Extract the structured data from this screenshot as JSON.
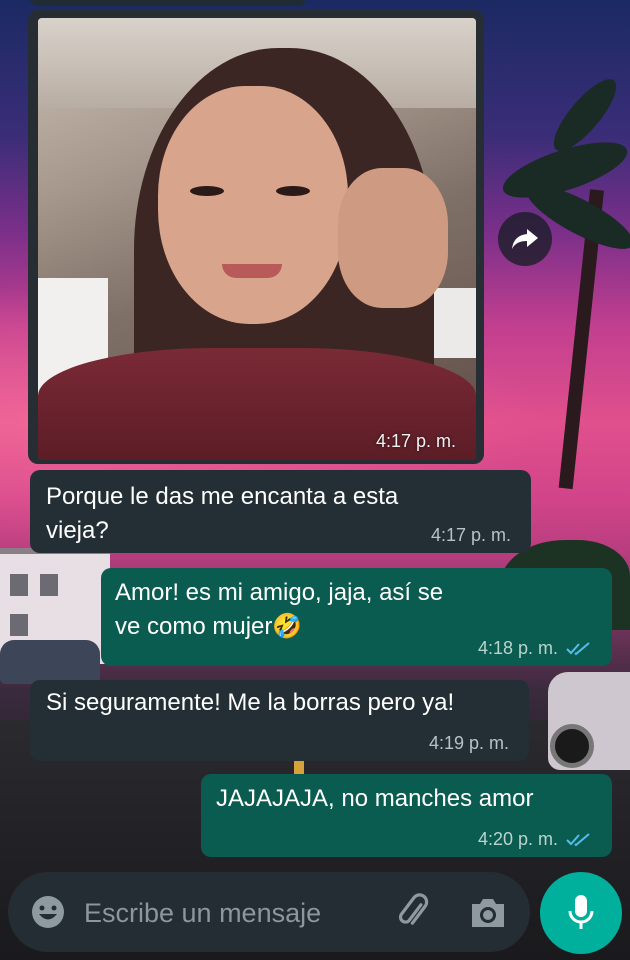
{
  "messages": [
    {
      "direction": "incoming",
      "type": "image",
      "time": "4:17 p. m."
    },
    {
      "direction": "incoming",
      "type": "text",
      "text": "Porque le das me encanta a esta vieja?",
      "time": "4:17 p. m."
    },
    {
      "direction": "outgoing",
      "type": "text",
      "text": "Amor! es mi amigo, jaja, así se ve como mujer🤣",
      "time": "4:18 p. m.",
      "status": "read"
    },
    {
      "direction": "incoming",
      "type": "text",
      "text": "Si seguramente! Me la borras pero ya!",
      "time": "4:19 p. m."
    },
    {
      "direction": "outgoing",
      "type": "text",
      "text": "JAJAJAJA, no manches amor",
      "time": "4:20 p. m.",
      "status": "read"
    }
  ],
  "composer": {
    "placeholder": "Escribe un mensaje",
    "emoji_icon": "emoji-icon",
    "attach_icon": "paperclip-icon",
    "camera_icon": "camera-icon",
    "mic_icon": "microphone-icon"
  },
  "forward_icon": "forward-arrow-icon",
  "colors": {
    "incoming_bubble": "#242f35",
    "outgoing_bubble": "#0b5c50",
    "read_ticks": "#53bdeb",
    "mic_button": "#00af9c",
    "cursor": "#00bfa5"
  }
}
